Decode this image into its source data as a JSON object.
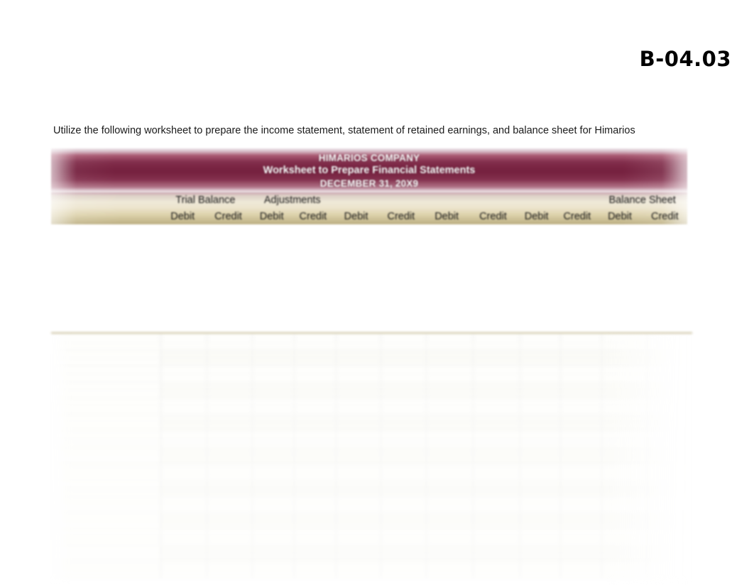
{
  "page": {
    "code": "B-04.03"
  },
  "instruction": {
    "text": "Utilize the following worksheet to prepare the income statement, statement of retained earnings, and balance sheet for Himarios"
  },
  "worksheet": {
    "title_lines": {
      "company": "HIMARIOS COMPANY",
      "subtitle": "Worksheet to Prepare Financial Statements",
      "date": "DECEMBER 31, 20X9"
    },
    "colors": {
      "title_band": "#75203e",
      "header_band_top": "#efe9d8",
      "header_band_bottom": "#bcae82",
      "grid_top_border": "#c9bf9c",
      "page_background": "#ffffff"
    },
    "column_groups": [
      {
        "label": "",
        "span": 1
      },
      {
        "label": "Trial Balance",
        "span": 2
      },
      {
        "label": "Adjustments",
        "span": 2
      },
      {
        "label": "",
        "span": 2
      },
      {
        "label": "",
        "span": 2
      },
      {
        "label": "",
        "span": 2
      },
      {
        "label": "Balance Sheet",
        "span": 2
      }
    ],
    "debit_credit_headers": [
      "",
      "Debit",
      "Credit",
      "Debit",
      "Credit",
      "Debit",
      "Credit",
      "Debit",
      "Credit",
      "Debit",
      "Credit",
      "Debit",
      "Credit"
    ],
    "grid": {
      "row_count": 15,
      "column_count": 13,
      "rows_empty": true
    }
  }
}
